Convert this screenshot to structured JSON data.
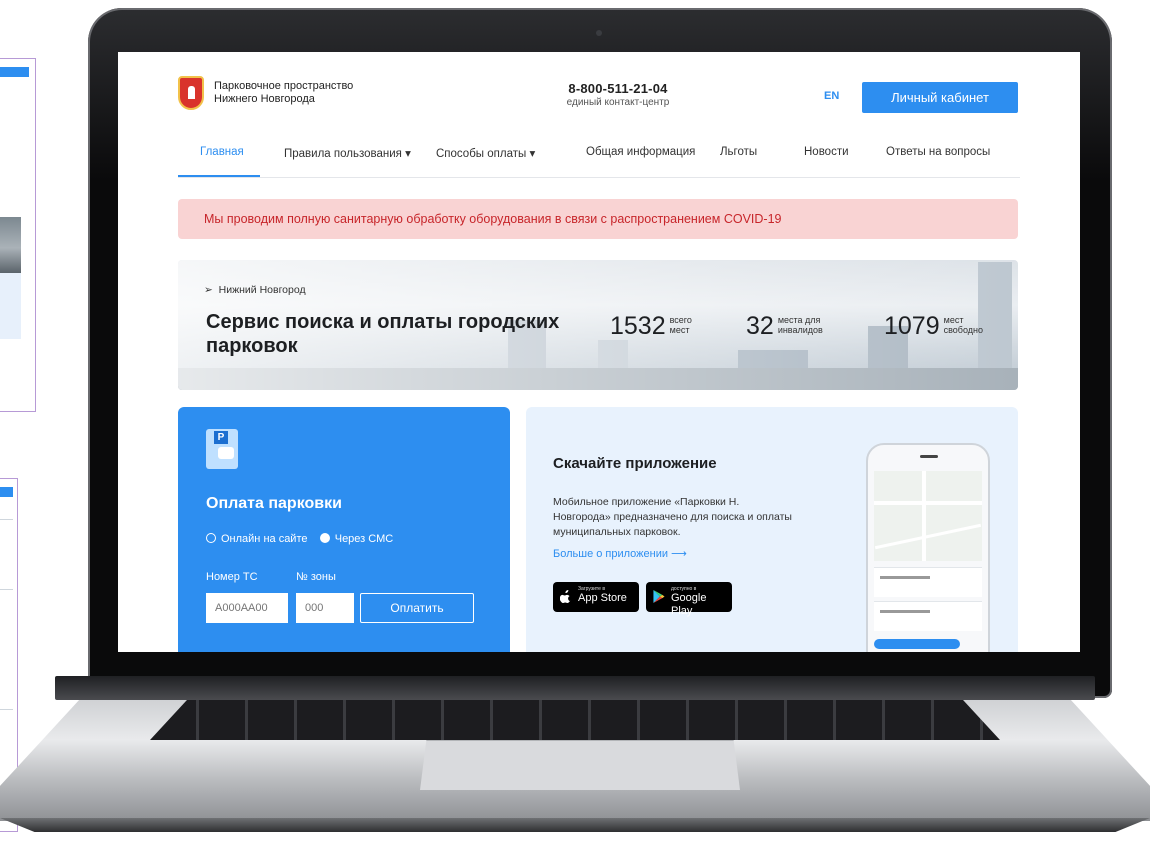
{
  "header": {
    "org_line1": "Парковочное пространство",
    "org_line2": "Нижнего Новгорода",
    "phone": "8-800-511-21-04",
    "phone_caption": "единый контакт-центр",
    "lang": "EN",
    "cabinet_label": "Личный кабинет"
  },
  "nav": {
    "items": [
      {
        "label": "Главная"
      },
      {
        "label": "Правила пользования ▾"
      },
      {
        "label": "Способы оплаты ▾"
      },
      {
        "label": "Общая информация"
      },
      {
        "label": "Льготы"
      },
      {
        "label": "Новости"
      },
      {
        "label": "Ответы на вопросы"
      }
    ]
  },
  "alert": {
    "text": "Мы проводим полную санитарную обработку оборудования в связи с распространением COVID-19"
  },
  "hero": {
    "city": "Нижний Новгород",
    "title": "Сервис поиска и оплаты городских парковок",
    "stats": [
      {
        "value": "1532",
        "line1": "всего",
        "line2": "мест"
      },
      {
        "value": "32",
        "line1": "места для",
        "line2": "инвалидов"
      },
      {
        "value": "1079",
        "line1": "мест",
        "line2": "свободно"
      }
    ]
  },
  "payment": {
    "title": "Оплата парковки",
    "icon_letter": "P",
    "option_online": "Онлайн на сайте",
    "option_sms": "Через СМС",
    "label_vehicle": "Номер ТС",
    "label_zone": "№ зоны",
    "vehicle_placeholder": "А000АА00",
    "zone_placeholder": "000",
    "pay_button": "Оплатить"
  },
  "app": {
    "title": "Скачайте приложение",
    "description": "Мобильное приложение «Парковки Н. Новгорода» предназначено для поиска и оплаты муниципальных парковок.",
    "more_link": "Больше о приложении ⟶",
    "appstore_small": "Загрузите в",
    "appstore_large": "App Store",
    "googleplay_small": "доступно в",
    "googleplay_large": "Google Play"
  },
  "colors": {
    "accent": "#2d8ef0",
    "alert_bg": "#f9d3d3",
    "alert_text": "#c7252a",
    "app_bg": "#e8f2fd"
  }
}
